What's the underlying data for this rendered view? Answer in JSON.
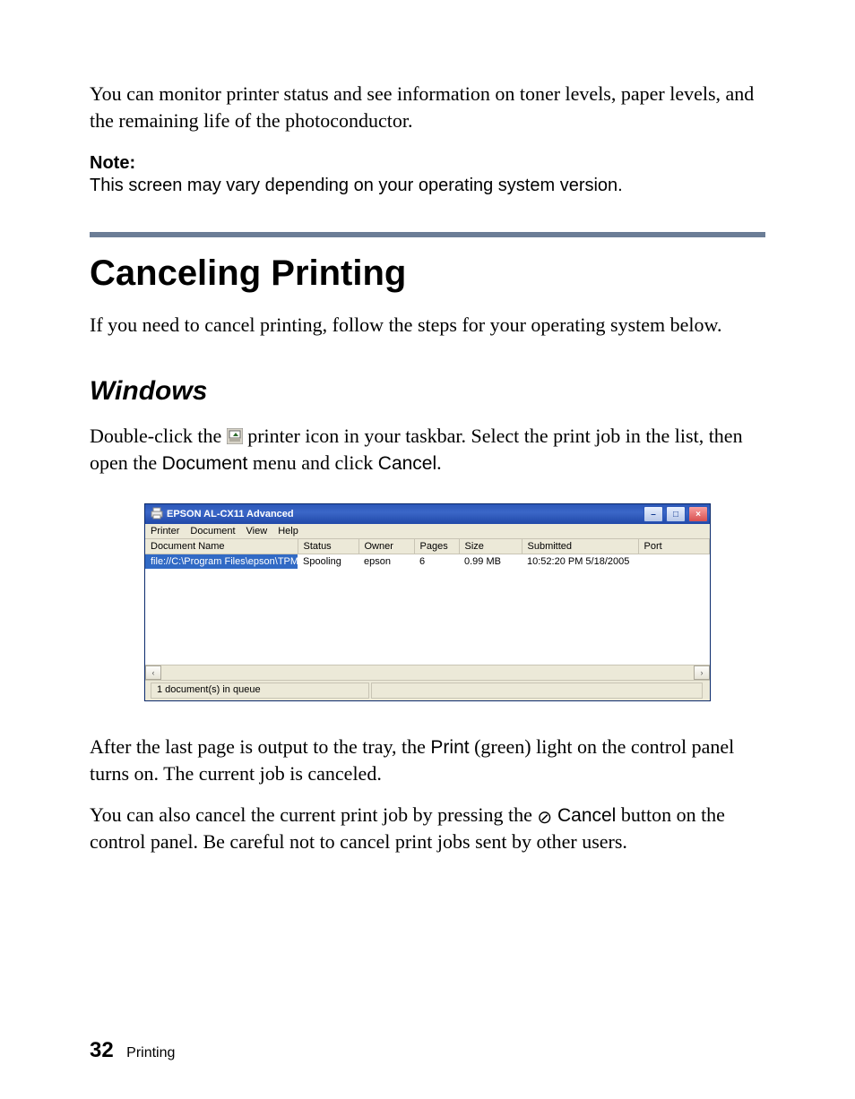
{
  "intro_paragraph": "You can monitor printer status and see information on toner levels, paper levels, and the remaining life of the photoconductor.",
  "note_label": "Note:",
  "note_body": "This screen may vary depending on your operating system version.",
  "section_heading": "Canceling Printing",
  "section_intro": "If you need to cancel printing, follow the steps for your operating system below.",
  "subsection_heading": "Windows",
  "instruction_pre_icon": "Double-click the ",
  "instruction_post_icon": " printer icon in your taskbar. Select the print job in the list, then open the ",
  "menu_document": "Document",
  "instruction_mid": " menu and click ",
  "menu_cancel": "Cancel",
  "instruction_period": ".",
  "after_para_a": "After the last page is output to the tray, the ",
  "after_para_print": "Print",
  "after_para_b": " (green) light on the control panel turns on. The current job is canceled.",
  "also_para_a": "You can also cancel the current print job by pressing the ",
  "cancel_symbol": "⊘",
  "also_para_cancel": " Cancel",
  "also_para_b": " button on the control panel. Be careful not to cancel print jobs sent by other users.",
  "window": {
    "title": "EPSON AL-CX11 Advanced",
    "menus": [
      "Printer",
      "Document",
      "View",
      "Help"
    ],
    "columns": [
      "Document Name",
      "Status",
      "Owner",
      "Pages",
      "Size",
      "Submitted",
      "Port"
    ],
    "row": {
      "name": "file://C:\\Program Files\\epson\\TPM…",
      "status": "Spooling",
      "owner": "epson",
      "pages": "6",
      "size": "0.99 MB",
      "submitted": "10:52:20 PM 5/18/2005",
      "port": ""
    },
    "status": "1 document(s) in queue"
  },
  "footer": {
    "page": "32",
    "section": "Printing"
  }
}
